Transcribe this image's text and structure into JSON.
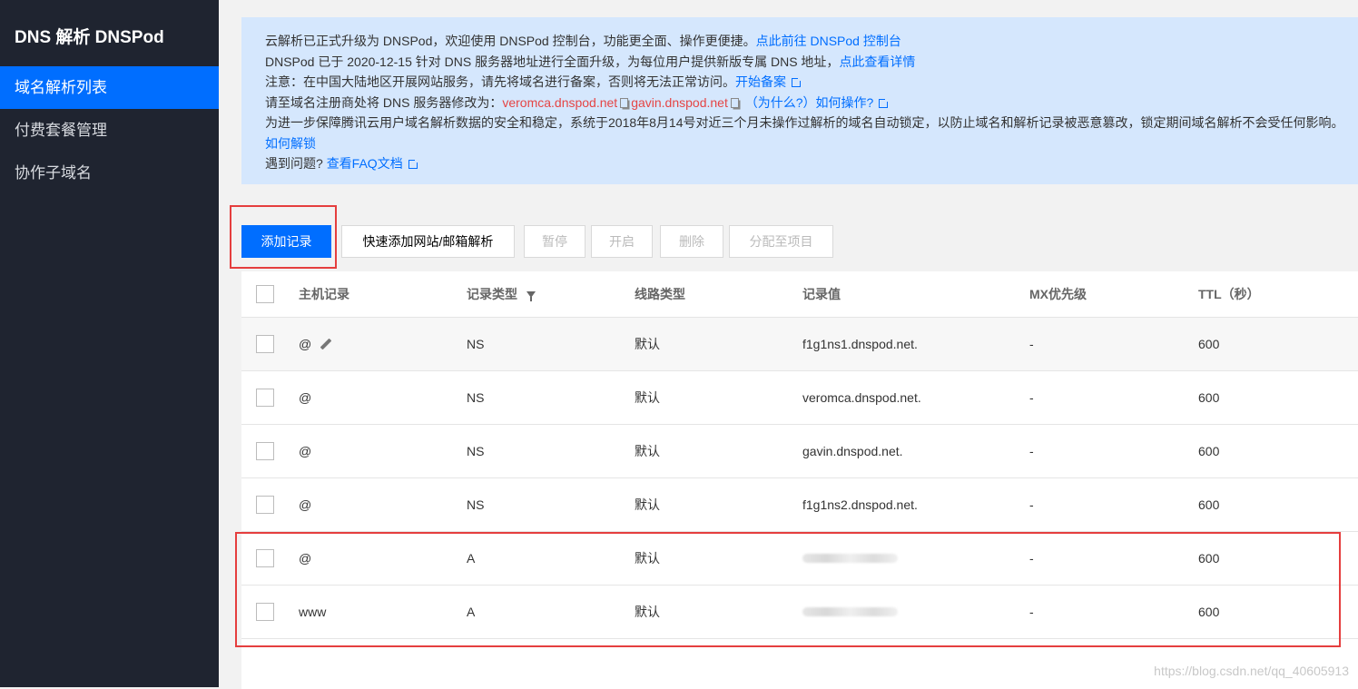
{
  "sidebar": {
    "brand": "DNS 解析 DNSPod",
    "items": [
      {
        "label": "域名解析列表"
      },
      {
        "label": "付费套餐管理"
      },
      {
        "label": "协作子域名"
      }
    ]
  },
  "notice": {
    "line1_text": "云解析已正式升级为 DNSPod，欢迎使用 DNSPod 控制台，功能更全面、操作更便捷。",
    "line1_link": "点此前往 DNSPod 控制台",
    "line2_text": "DNSPod 已于 2020-12-15 针对 DNS 服务器地址进行全面升级，为每位用户提供新版专属 DNS 地址，",
    "line2_link": "点此查看详情",
    "line3_text": "注意：在中国大陆地区开展网站服务，请先将域名进行备案，否则将无法正常访问。",
    "line3_link": "开始备案",
    "line4_text": "请至域名注册商处将 DNS 服务器修改为：",
    "ns1": "veromca.dnspod.net",
    "ns2": "gavin.dnspod.net",
    "line4_link1": "（为什么?）",
    "line4_link2": "如何操作?",
    "line5_text": "为进一步保障腾讯云用户域名解析数据的安全和稳定，系统于2018年8月14号对近三个月未操作过解析的域名自动锁定，以防止域名和解析记录被恶意篡改，锁定期间域名解析不会受任何影响。",
    "line6_link": "如何解锁",
    "line7_text": "遇到问题?",
    "line7_link": "查看FAQ文档"
  },
  "toolbar": {
    "add": "添加记录",
    "quick_add": "快速添加网站/邮箱解析",
    "pause": "暂停",
    "enable": "开启",
    "delete": "删除",
    "assign": "分配至项目"
  },
  "table": {
    "headers": {
      "host": "主机记录",
      "type": "记录类型",
      "line": "线路类型",
      "value": "记录值",
      "mx": "MX优先级",
      "ttl": "TTL（秒）"
    },
    "rows": [
      {
        "host": "@",
        "type": "NS",
        "line": "默认",
        "value": "f1g1ns1.dnspod.net.",
        "mx": "-",
        "ttl": "600"
      },
      {
        "host": "@",
        "type": "NS",
        "line": "默认",
        "value": "veromca.dnspod.net.",
        "mx": "-",
        "ttl": "600"
      },
      {
        "host": "@",
        "type": "NS",
        "line": "默认",
        "value": "gavin.dnspod.net.",
        "mx": "-",
        "ttl": "600"
      },
      {
        "host": "@",
        "type": "NS",
        "line": "默认",
        "value": "f1g1ns2.dnspod.net.",
        "mx": "-",
        "ttl": "600"
      },
      {
        "host": "@",
        "type": "A",
        "line": "默认",
        "value": "",
        "mx": "-",
        "ttl": "600"
      },
      {
        "host": "www",
        "type": "A",
        "line": "默认",
        "value": "",
        "mx": "-",
        "ttl": "600"
      }
    ]
  },
  "watermark": "https://blog.csdn.net/qq_40605913"
}
